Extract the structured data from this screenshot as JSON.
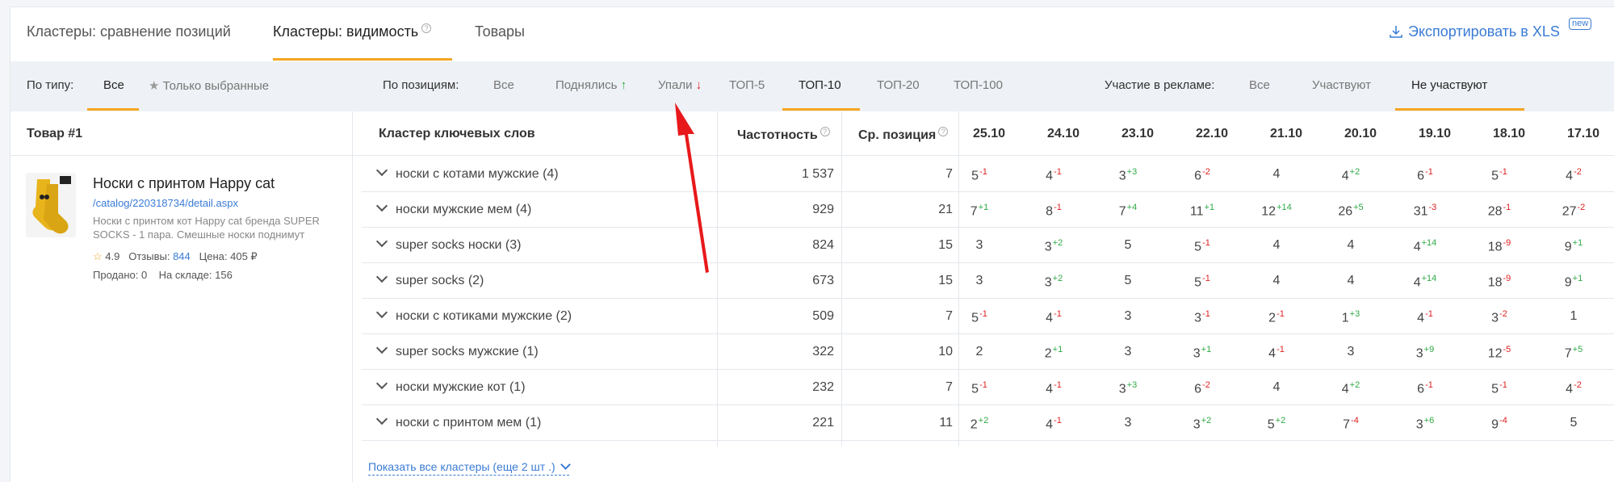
{
  "tabs": [
    {
      "label": "Кластеры: сравнение позиций"
    },
    {
      "label": "Кластеры: видимость",
      "help": "?"
    },
    {
      "label": "Товары"
    }
  ],
  "export": {
    "label": "Экспортировать в XLS",
    "badge": "new"
  },
  "filters": {
    "type_label": "По типу:",
    "type_all": "Все",
    "type_selected": "Только выбранные",
    "pos_label": "По позициям:",
    "pos_all": "Все",
    "pos_up": "Поднялись",
    "pos_up_arrow": "↑",
    "pos_down": "Упали",
    "pos_down_arrow": "↓",
    "top5": "ТОП-5",
    "top10": "ТОП-10",
    "top20": "ТОП-20",
    "top100": "ТОП-100",
    "ad_label": "Участие в рекламе:",
    "ad_all": "Все",
    "ad_yes": "Участвуют",
    "ad_no": "Не участвуют"
  },
  "table": {
    "col_product": "Товар #1",
    "col_cluster": "Кластер ключевых слов",
    "col_freq": "Частотность",
    "col_avg": "Ср. позиция",
    "help": "?",
    "dates": [
      "25.10",
      "24.10",
      "23.10",
      "22.10",
      "21.10",
      "20.10",
      "19.10",
      "18.10",
      "17.10"
    ],
    "rows": [
      {
        "keyword": "носки с котами мужские (4)",
        "freq": "1 537",
        "avg": "7",
        "pos": [
          [
            "5",
            "-1"
          ],
          [
            "4",
            "-1"
          ],
          [
            "3",
            "+3"
          ],
          [
            "6",
            "-2"
          ],
          [
            "4",
            ""
          ],
          [
            "4",
            "+2"
          ],
          [
            "6",
            "-1"
          ],
          [
            "5",
            "-1"
          ],
          [
            "4",
            "-2"
          ]
        ]
      },
      {
        "keyword": "носки мужские мем (4)",
        "freq": "929",
        "avg": "21",
        "pos": [
          [
            "7",
            "+1"
          ],
          [
            "8",
            "-1"
          ],
          [
            "7",
            "+4"
          ],
          [
            "11",
            "+1"
          ],
          [
            "12",
            "+14"
          ],
          [
            "26",
            "+5"
          ],
          [
            "31",
            "-3"
          ],
          [
            "28",
            "-1"
          ],
          [
            "27",
            "-2"
          ]
        ]
      },
      {
        "keyword": "super socks носки (3)",
        "freq": "824",
        "avg": "15",
        "pos": [
          [
            "3",
            ""
          ],
          [
            "3",
            "+2"
          ],
          [
            "5",
            ""
          ],
          [
            "5",
            "-1"
          ],
          [
            "4",
            ""
          ],
          [
            "4",
            ""
          ],
          [
            "4",
            "+14"
          ],
          [
            "18",
            "-9"
          ],
          [
            "9",
            "+1"
          ]
        ]
      },
      {
        "keyword": "super socks (2)",
        "freq": "673",
        "avg": "15",
        "pos": [
          [
            "3",
            ""
          ],
          [
            "3",
            "+2"
          ],
          [
            "5",
            ""
          ],
          [
            "5",
            "-1"
          ],
          [
            "4",
            ""
          ],
          [
            "4",
            ""
          ],
          [
            "4",
            "+14"
          ],
          [
            "18",
            "-9"
          ],
          [
            "9",
            "+1"
          ]
        ]
      },
      {
        "keyword": "носки с котиками мужские (2)",
        "freq": "509",
        "avg": "7",
        "pos": [
          [
            "5",
            "-1"
          ],
          [
            "4",
            "-1"
          ],
          [
            "3",
            ""
          ],
          [
            "3",
            "-1"
          ],
          [
            "2",
            "-1"
          ],
          [
            "1",
            "+3"
          ],
          [
            "4",
            "-1"
          ],
          [
            "3",
            "-2"
          ],
          [
            "1",
            ""
          ]
        ]
      },
      {
        "keyword": "super socks мужские (1)",
        "freq": "322",
        "avg": "10",
        "pos": [
          [
            "2",
            ""
          ],
          [
            "2",
            "+1"
          ],
          [
            "3",
            ""
          ],
          [
            "3",
            "+1"
          ],
          [
            "4",
            "-1"
          ],
          [
            "3",
            ""
          ],
          [
            "3",
            "+9"
          ],
          [
            "12",
            "-5"
          ],
          [
            "7",
            "+5"
          ]
        ]
      },
      {
        "keyword": "носки мужские кот (1)",
        "freq": "232",
        "avg": "7",
        "pos": [
          [
            "5",
            "-1"
          ],
          [
            "4",
            "-1"
          ],
          [
            "3",
            "+3"
          ],
          [
            "6",
            "-2"
          ],
          [
            "4",
            ""
          ],
          [
            "4",
            "+2"
          ],
          [
            "6",
            "-1"
          ],
          [
            "5",
            "-1"
          ],
          [
            "4",
            "-2"
          ]
        ]
      },
      {
        "keyword": "носки с принтом мем (1)",
        "freq": "221",
        "avg": "11",
        "pos": [
          [
            "2",
            "+2"
          ],
          [
            "4",
            "-1"
          ],
          [
            "3",
            ""
          ],
          [
            "3",
            "+2"
          ],
          [
            "5",
            "+2"
          ],
          [
            "7",
            "-4"
          ],
          [
            "3",
            "+6"
          ],
          [
            "9",
            "-4"
          ],
          [
            "5",
            ""
          ]
        ]
      }
    ],
    "show_all": "Показать все кластеры (еще 2 шт .)"
  },
  "product": {
    "title": "Носки с принтом Happy cat",
    "link": "/catalog/220318734/detail.aspx",
    "desc": "Носки с принтом кот Happy cat бренда SUPER SOCKS - 1 пара. Смешные носки поднимут",
    "rating": "4.9",
    "reviews_label": "Отзывы:",
    "reviews": "844",
    "price_label": "Цена:",
    "price": "405 ₽",
    "sold_label": "Продано:",
    "sold": "0",
    "stock_label": "На складе:",
    "stock": "156"
  },
  "colors": {
    "accent": "#f5a623",
    "link": "#3a7bd5",
    "up": "#2eaa45",
    "down": "#e02020",
    "annotation": "#e8191b"
  }
}
